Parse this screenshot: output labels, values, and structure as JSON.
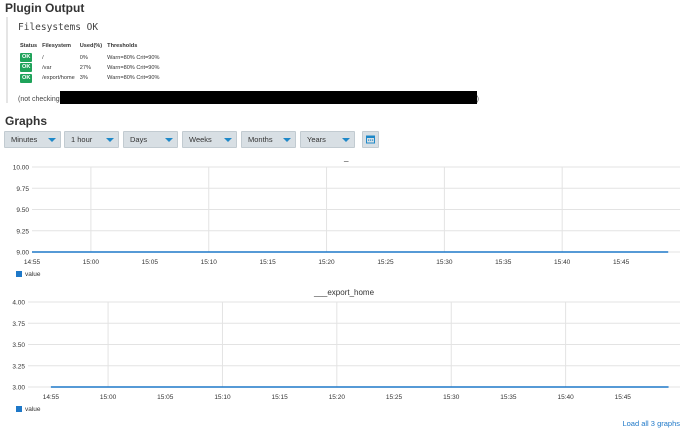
{
  "plugin": {
    "title": "Plugin Output",
    "status_line": "Filesystems OK",
    "table": {
      "headers": [
        "Status",
        "Filesystem",
        "Used(%)",
        "Thresholds"
      ],
      "rows": [
        {
          "status": "OK",
          "fs": "/",
          "used": "0%",
          "thresholds": "Warn=80% Crit=90%"
        },
        {
          "status": "OK",
          "fs": "/var",
          "used": "27%",
          "thresholds": "Warn=80% Crit=90%"
        },
        {
          "status": "OK",
          "fs": "/export/home",
          "used": "3%",
          "thresholds": "Warn=80% Crit=90%"
        }
      ]
    },
    "not_checking_prefix": "(not checking",
    "not_checking_suffix": ")"
  },
  "graphs": {
    "title": "Graphs",
    "dropdowns": [
      "Minutes",
      "1 hour",
      "Days",
      "Weeks",
      "Months",
      "Years"
    ],
    "calendar_icon": "calendar-icon",
    "load_all_label": "Load all 3 graphs",
    "legend_label": "value",
    "series_color": "#1e78c8"
  },
  "chart_data": [
    {
      "type": "line",
      "title": "_",
      "xlabel": "",
      "ylabel": "",
      "x_ticks": [
        "14:55",
        "15:00",
        "15:05",
        "15:10",
        "15:15",
        "15:20",
        "15:25",
        "15:30",
        "15:35",
        "15:40",
        "15:45"
      ],
      "y_ticks": [
        "10.00",
        "9.75",
        "9.50",
        "9.25",
        "9.00"
      ],
      "ylim": [
        9.0,
        10.0
      ],
      "series": [
        {
          "name": "value",
          "x": [
            "14:55",
            "15:49"
          ],
          "y": [
            9.0,
            9.0
          ]
        }
      ],
      "grid": true,
      "legend": "bottom-left"
    },
    {
      "type": "line",
      "title": "___export_home",
      "xlabel": "",
      "ylabel": "",
      "x_ticks": [
        "14:55",
        "15:00",
        "15:05",
        "15:10",
        "15:15",
        "15:20",
        "15:25",
        "15:30",
        "15:35",
        "15:40",
        "15:45"
      ],
      "y_ticks": [
        "4.00",
        "3.75",
        "3.50",
        "3.25",
        "3.00"
      ],
      "ylim": [
        3.0,
        4.0
      ],
      "series": [
        {
          "name": "value",
          "x": [
            "14:55",
            "15:49"
          ],
          "y": [
            3.0,
            3.0
          ]
        }
      ],
      "grid": true,
      "legend": "bottom-left"
    }
  ]
}
